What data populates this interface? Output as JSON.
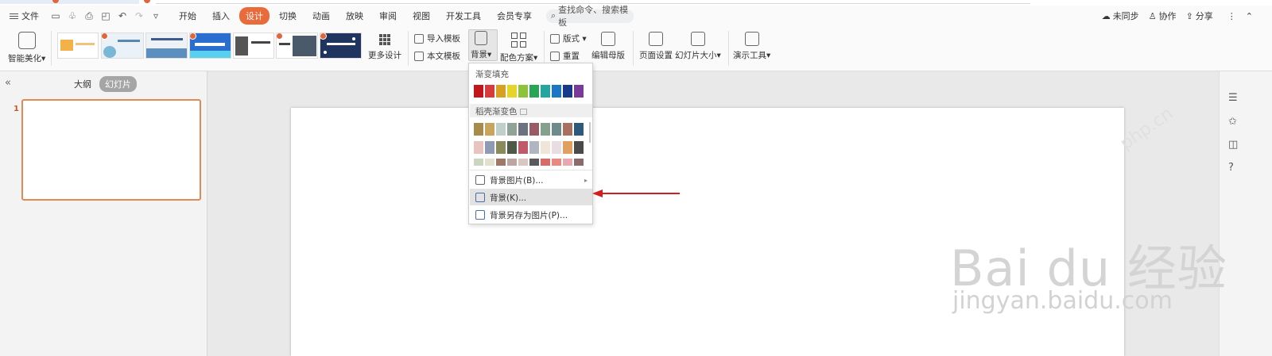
{
  "menubar": {
    "file_label": "文件",
    "tabs": [
      "开始",
      "插入",
      "设计",
      "切换",
      "动画",
      "放映",
      "审阅",
      "视图",
      "开发工具",
      "会员专享"
    ],
    "active_tab": "设计",
    "search_text": "查找命令、搜索模板",
    "sync": "未同步",
    "collab": "协作",
    "share": "分享"
  },
  "ribbon": {
    "smart_beautify": "智能美化",
    "more_designs": "更多设计",
    "import_template": "导入模板",
    "body_template": "本文模板",
    "background": "背景",
    "color_scheme": "配色方案",
    "layout": "版式",
    "reset": "重置",
    "edit_master": "编辑母版",
    "page_setup": "页面设置",
    "slide_size": "幻灯片大小",
    "presentation_tools": "演示工具"
  },
  "left_panel": {
    "outline_tab": "大纲",
    "slides_tab": "幻灯片",
    "slide_number": "1"
  },
  "dropdown": {
    "gradient_fill": "渐变填充",
    "docer_gradient": "稻壳渐变色",
    "bg_picture": "背景图片(B)...",
    "bg": "背景(K)...",
    "save_bg_as_picture": "背景另存为图片(P)...",
    "gradient_colors": [
      "#c2161c",
      "#d83b3b",
      "#d8a021",
      "#e5d52b",
      "#8ec23b",
      "#2aa558",
      "#24a6a0",
      "#1c76c4",
      "#18388c",
      "#7a3a9a"
    ],
    "docer_rows": [
      [
        "#a88b4a",
        "#c9a45c",
        "#bfcfc9",
        "#8fa397",
        "#6d7280",
        "#9a5a66",
        "#86a08e",
        "#6e8a8a",
        "#a87060",
        "#2d5a7a"
      ],
      [
        "#e8c4c0",
        "#8f9bb3",
        "#8a8a5a",
        "#4d5a4a",
        "#c05a6a",
        "#b0b5c0",
        "#efe6d9",
        "#e8dde0",
        "#e0a060",
        "#4a4a4a"
      ],
      [
        "#c9d6c0",
        "#e4e0d0",
        "#a0786a",
        "#bfa4a4",
        "#d8c8c0",
        "#5a5a5a",
        "#d86a6a",
        "#e88a80",
        "#e8a8b0",
        "#8a6a6a"
      ]
    ]
  },
  "watermark": {
    "brand": "Bai du 经验",
    "url": "jingyan.baidu.com",
    "site": "php.cn"
  }
}
